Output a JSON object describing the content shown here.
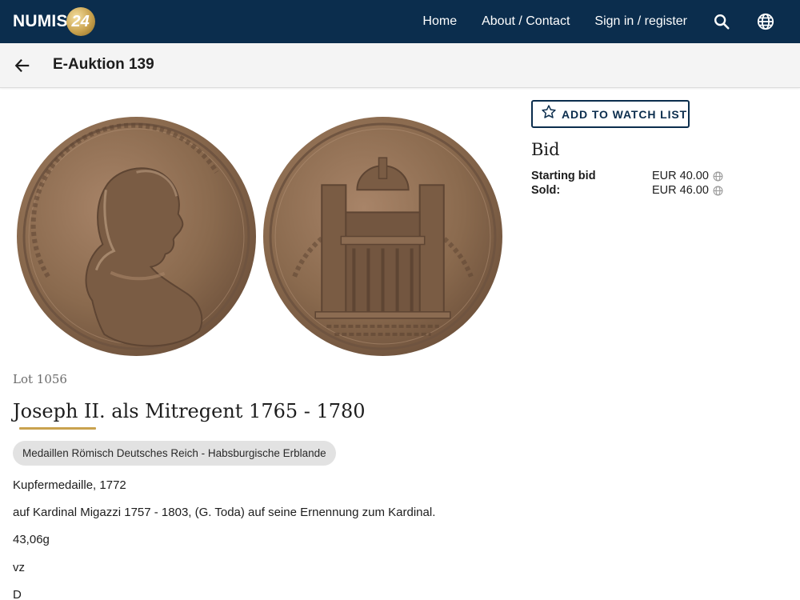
{
  "header": {
    "logo_text": "NUMIS",
    "logo_badge": "24",
    "nav": [
      "Home",
      "About / Contact",
      "Sign in / register"
    ],
    "icons": [
      "search-icon",
      "globe-icon"
    ]
  },
  "subheader": {
    "title": "E-Auktion 139",
    "back_icon": "arrow-left-icon"
  },
  "bid_panel": {
    "watch_button": "ADD TO WATCH LIST",
    "heading": "Bid",
    "rows": [
      {
        "label": "Starting bid",
        "value": "EUR 40.00"
      },
      {
        "label": "Sold:",
        "value": "EUR 46.00"
      }
    ]
  },
  "lot": {
    "number": "Lot 1056",
    "title": "Joseph II. als Mitregent 1765 - 1780",
    "category": "Medaillen Römisch Deutsches Reich - Habsburgische Erblande",
    "description": [
      "Kupfermedaille, 1772",
      "auf Kardinal Migazzi 1757 - 1803, (G. Toda) auf seine Ernennung zum Kardinal.",
      "43,06g",
      "vz",
      "D"
    ]
  },
  "colors": {
    "nav_bg": "#0b2d4d",
    "accent_gold": "#c9a24e",
    "coin_bronze": "#8a6a4e"
  }
}
